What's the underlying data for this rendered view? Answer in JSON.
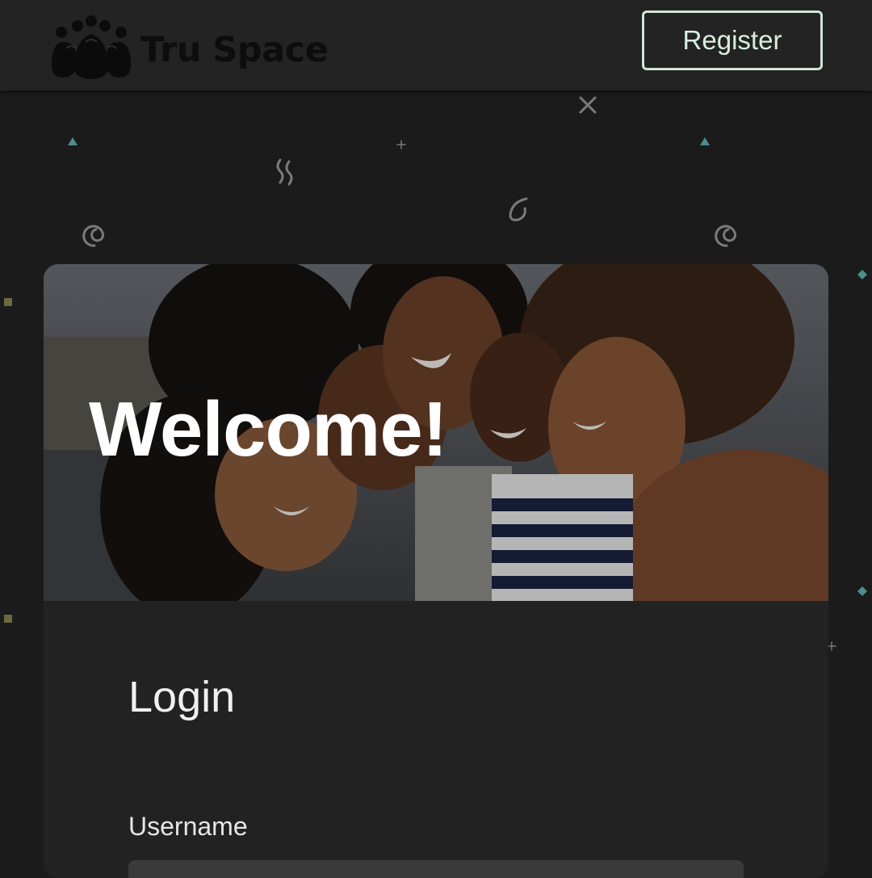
{
  "header": {
    "brand_name": "Tru Space",
    "logo_icon": "people-group-icon",
    "register_label": "Register",
    "accent_color": "#cfe6d6"
  },
  "hero": {
    "title": "Welcome!",
    "image_subject": "group-photo"
  },
  "login": {
    "title": "Login",
    "username_label": "Username",
    "username_value": "",
    "username_placeholder": ""
  }
}
